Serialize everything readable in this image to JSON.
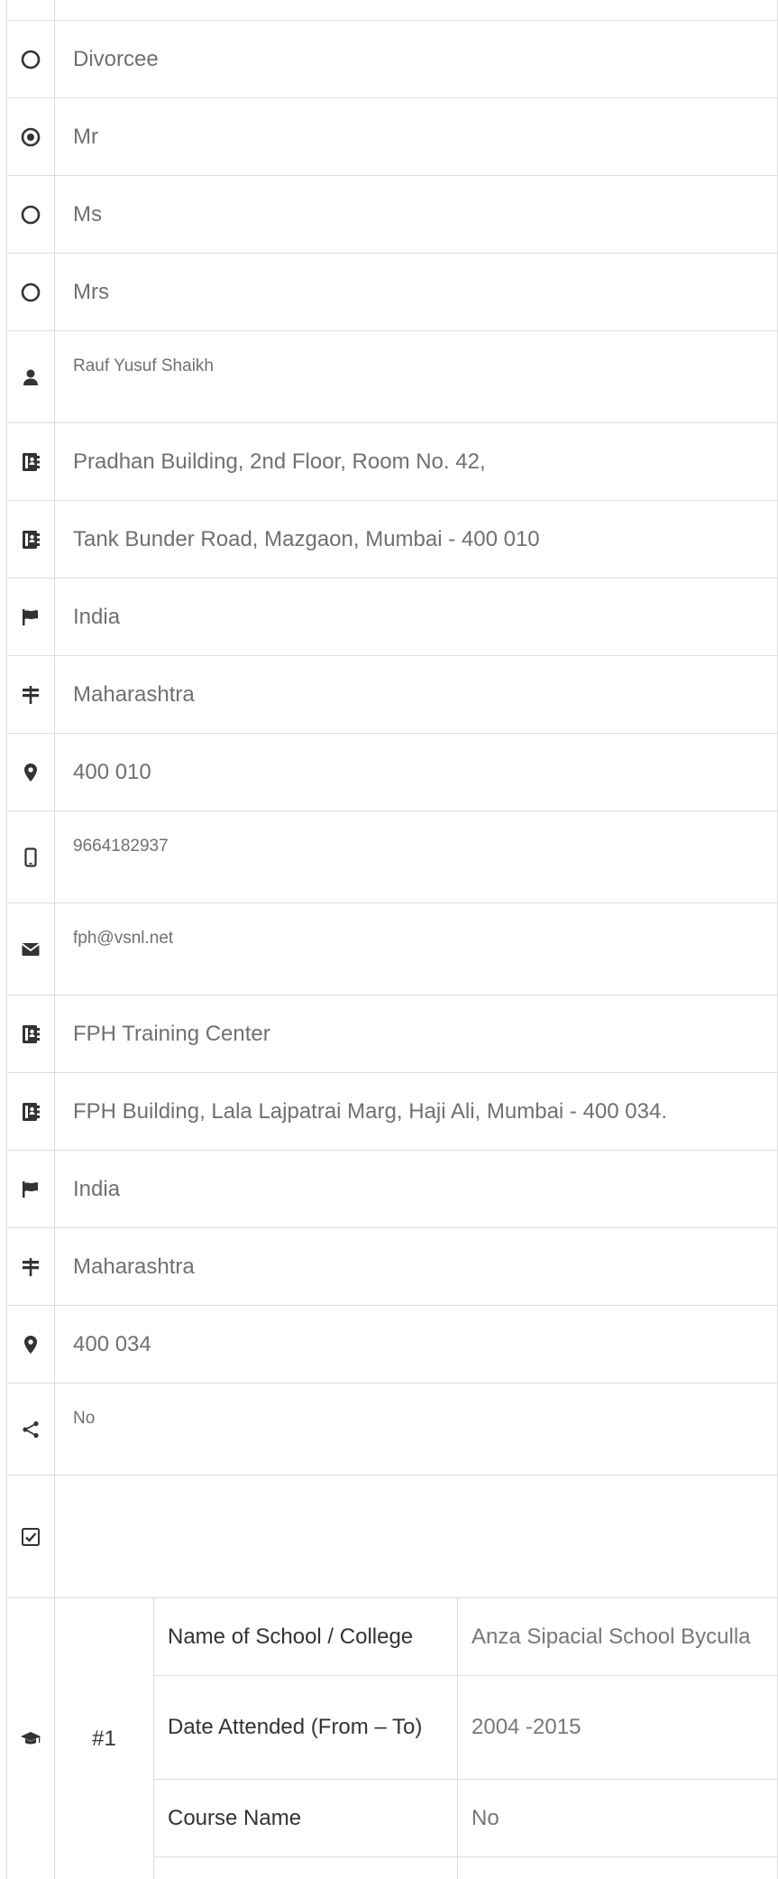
{
  "options": [
    {
      "label": "Divorcee",
      "selected": false
    },
    {
      "label": "Mr",
      "selected": true
    },
    {
      "label": "Ms",
      "selected": false
    },
    {
      "label": "Mrs",
      "selected": false
    }
  ],
  "fields": {
    "full_name": "Rauf Yusuf Shaikh",
    "address_line1": "Pradhan Building, 2nd Floor, Room No. 42,",
    "address_line2": "Tank Bunder Road, Mazgaon, Mumbai - 400 010",
    "country": "India",
    "state": "Maharashtra",
    "pincode": "400 010",
    "mobile": "9664182937",
    "email": "fph@vsnl.net",
    "office_name": "FPH Training Center",
    "office_address": "FPH Building, Lala Lajpatrai Marg, Haji Ali, Mumbai - 400 034.",
    "office_country": "India",
    "office_state": "Maharashtra",
    "office_pincode": "400 034",
    "referral": "No",
    "checklist": ""
  },
  "education": {
    "index": "#1",
    "rows": [
      {
        "label": "Name of School / College",
        "value": "Anza Sipacial School Byculla"
      },
      {
        "label": "Date Attended (From – To)",
        "value": "2004 -2015"
      },
      {
        "label": "Course Name",
        "value": "No"
      },
      {
        "label": "",
        "value": ""
      }
    ]
  },
  "icons": {
    "radio": "radio-icon",
    "user": "user-icon",
    "address": "address-book-icon",
    "flag": "flag-icon",
    "signpost": "signpost-icon",
    "location": "map-marker-icon",
    "mobile": "mobile-icon",
    "email": "envelope-icon",
    "share": "share-icon",
    "check": "check-square-icon",
    "education": "graduation-cap-icon"
  },
  "colors": {
    "border": "#dcdcdc",
    "icon": "#333333",
    "value_text": "#707070",
    "label_text": "#333333"
  }
}
